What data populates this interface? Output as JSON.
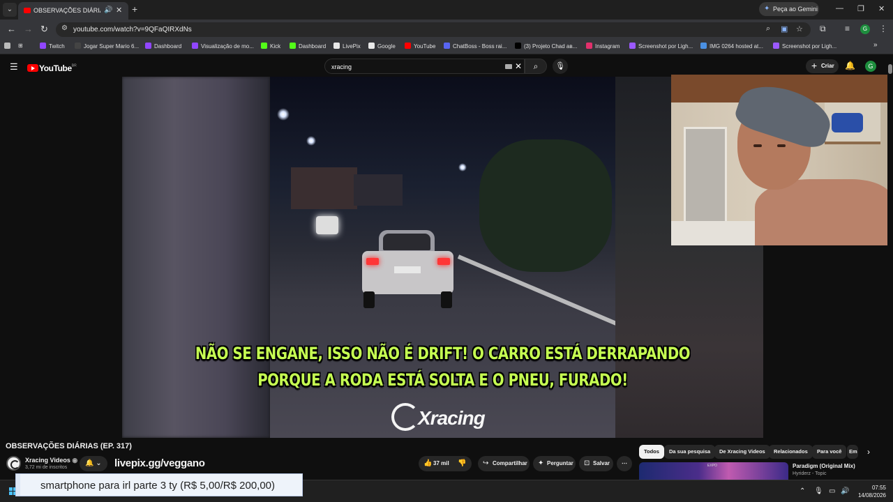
{
  "browser": {
    "tab_title": "OBSERVAÇÕES DIÁRIAS (EP.",
    "gemini_label": "Peça ao Gemini",
    "url": "youtube.com/watch?v=9QFaQIRXdNs",
    "profile_initial": "G",
    "bookmarks": [
      {
        "label": "Twitch",
        "icon": "twitch-icon",
        "color": "#9146ff"
      },
      {
        "label": "Jogar Super Mario 6...",
        "icon": "game-icon",
        "color": "#444"
      },
      {
        "label": "Dashboard",
        "icon": "twitch-icon",
        "color": "#9146ff"
      },
      {
        "label": "Visualização de mo...",
        "icon": "twitch-icon",
        "color": "#9146ff"
      },
      {
        "label": "Kick",
        "icon": "kick-icon",
        "color": "#53fc18"
      },
      {
        "label": "Dashboard",
        "icon": "kick-icon",
        "color": "#53fc18"
      },
      {
        "label": "LivePix",
        "icon": "livepix-icon",
        "color": "#e8e8e8"
      },
      {
        "label": "Google",
        "icon": "google-icon",
        "color": "#e8e8e8"
      },
      {
        "label": "YouTube",
        "icon": "youtube-icon",
        "color": "#ff0000"
      },
      {
        "label": "ChatBoss - Boss rai...",
        "icon": "chatboss-icon",
        "color": "#5865f2"
      },
      {
        "label": "(3) Projeto Chad ав...",
        "icon": "x-icon",
        "color": "#000000"
      },
      {
        "label": "Instagram",
        "icon": "instagram-icon",
        "color": "#e1306c"
      },
      {
        "label": "Screenshot por Ligh...",
        "icon": "lightshot-icon",
        "color": "#9b59ff"
      },
      {
        "label": "IMG 0264 hosted at...",
        "icon": "imgbb-icon",
        "color": "#4a90e2"
      },
      {
        "label": "Screenshot por Ligh...",
        "icon": "lightshot-icon",
        "color": "#9b59ff"
      }
    ]
  },
  "youtube": {
    "logo_text": "YouTube",
    "logo_country": "BR",
    "search_query": "xracing",
    "create_label": "Criar",
    "avatar_initial": "G",
    "video": {
      "subtitle_line1": "NÃO SE ENGANE, ISSO NÃO É DRIFT! O CARRO ESTÁ DERRAPANDO",
      "subtitle_line2": "PORQUE A RODA ESTÁ SOLTA E O PNEU, FURADO!",
      "watermark": "Xracing"
    },
    "title": "OBSERVAÇÕES DIÁRIAS (EP. 317)",
    "channel_name": "Xracing Videos",
    "channel_subs": "3,72 mi de inscritos",
    "overlay_link": "livepix.gg/veggano",
    "likes": "37 mil",
    "share_label": "Compartilhar",
    "ask_label": "Perguntar",
    "save_label": "Salvar",
    "chips": [
      "Todos",
      "Da sua pesquisa",
      "De Xracing Videos",
      "Relacionados",
      "Para você",
      "Em"
    ],
    "recommendation": {
      "title": "Paradigm (Original Mix)",
      "channel": "Hyriderz - Topic",
      "thumb_text": "EXPO"
    }
  },
  "donation": {
    "text": "smartphone para irl parte 3 ty (R$ 5,00/R$ 200,00)"
  },
  "taskbar": {
    "time": "07:55",
    "date": "14/08/2026"
  }
}
